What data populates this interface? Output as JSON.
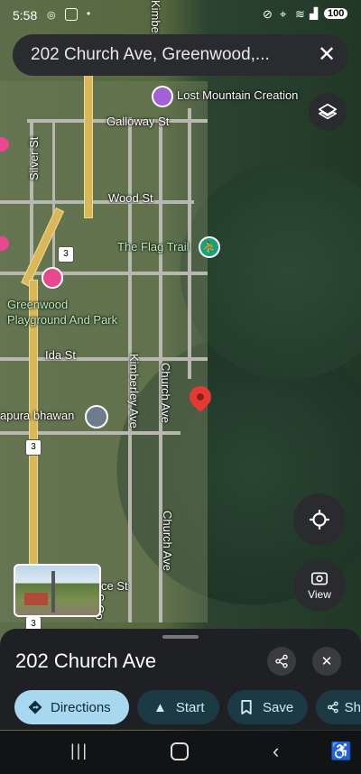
{
  "status": {
    "time": "5:58",
    "battery": "100"
  },
  "search": {
    "query": "202 Church Ave, Greenwood,..."
  },
  "map": {
    "labels": {
      "lost_mountain": "Lost Mountain Creation",
      "galloway": "Galloway St",
      "silver": "Silver St",
      "kimber_top": "Kimber",
      "wood": "Wood St",
      "flag_trail": "The Flag Trail",
      "playground_line1": "Greenwood",
      "playground_line2": "Playground And Park",
      "ida": "Ida St",
      "kimberley": "Kimberley Ave",
      "church_1": "Church Ave",
      "church_2": "Church Ave",
      "bhawan": "apura bhawan",
      "ce_st": "ce St",
      "s_co": "S Co",
      "hwy_shield": "3"
    }
  },
  "buttons": {
    "view_label": "View"
  },
  "place": {
    "title": "202 Church Ave"
  },
  "actions": {
    "directions": "Directions",
    "start": "Start",
    "save": "Save",
    "share": "Sh"
  },
  "colors": {
    "accent": "#a8d8f0",
    "chip_dark": "#1b3a44",
    "pin": "#e53935"
  }
}
